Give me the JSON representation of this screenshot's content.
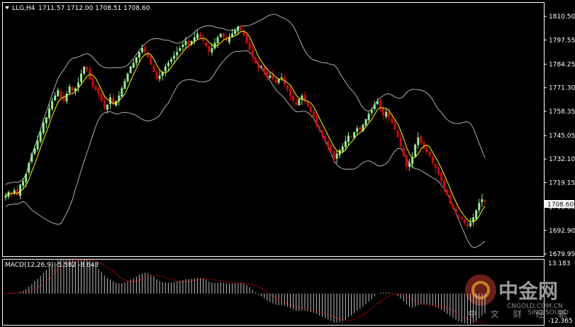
{
  "header": {
    "symbol_label": "LLG,H4",
    "ohlc": "1711.57 1712.00 1708.51 1708.60"
  },
  "price_axis": {
    "ticks": [
      "1810.50",
      "1797.55",
      "1784.25",
      "1771.30",
      "1758.35",
      "1745.05",
      "1732.10",
      "1719.15",
      "1705.85",
      "1692.90",
      "1679.95"
    ],
    "current_price": "1708.60"
  },
  "macd": {
    "label": "MACD(12,26,9) -5.582 -8.648",
    "ticks": [
      "13.183",
      "-12.365"
    ]
  },
  "watermark": {
    "brand_cn": "中金网",
    "domain": "CNGOLD.COM.CN",
    "slogan_cn": "中 文 财 经 新 闻",
    "sinosound": "SINO SOUND"
  },
  "colors": {
    "bull": "#90ee90",
    "bear": "#e00000",
    "band": "#b0b0b0",
    "ma": "#ffff00",
    "macd_hist": "#c0c0c0",
    "signal": "#ff0000",
    "frame": "#ffffff"
  },
  "chart_data": {
    "type": "candlestick",
    "y_range": [
      1679.95,
      1812.5
    ],
    "closes": [
      1712,
      1714,
      1713,
      1715,
      1712,
      1718,
      1720,
      1724,
      1730,
      1735,
      1738,
      1742,
      1747,
      1752,
      1755,
      1760,
      1764,
      1767,
      1770,
      1766,
      1764,
      1768,
      1772,
      1770,
      1771,
      1774,
      1779,
      1783,
      1781,
      1776,
      1772,
      1770,
      1768,
      1764,
      1760,
      1762,
      1766,
      1762,
      1764,
      1767,
      1771,
      1775,
      1779,
      1783,
      1785,
      1788,
      1791,
      1793,
      1791,
      1788,
      1784,
      1780,
      1776,
      1778,
      1780,
      1783,
      1785,
      1787,
      1789,
      1791,
      1793,
      1795,
      1797,
      1795,
      1797,
      1799,
      1801,
      1799,
      1797,
      1794,
      1791,
      1793,
      1796,
      1799,
      1801,
      1799,
      1797,
      1799,
      1801,
      1803,
      1805,
      1803,
      1800,
      1796,
      1792,
      1788,
      1785,
      1782,
      1783,
      1780,
      1777,
      1778,
      1776,
      1774,
      1776,
      1777,
      1773,
      1770,
      1767,
      1764,
      1762,
      1765,
      1767,
      1764,
      1761,
      1758,
      1755,
      1751,
      1748,
      1745,
      1742,
      1739,
      1736,
      1732,
      1735,
      1737,
      1739,
      1742,
      1745,
      1744,
      1747,
      1749,
      1748,
      1751,
      1754,
      1757,
      1759,
      1762,
      1764,
      1760,
      1756,
      1758,
      1755,
      1752,
      1748,
      1744,
      1739,
      1734,
      1728,
      1730,
      1733,
      1740,
      1744,
      1741,
      1738,
      1736,
      1734,
      1730,
      1727,
      1724,
      1720,
      1716,
      1712,
      1708,
      1705,
      1702,
      1700,
      1699,
      1697,
      1695,
      1697,
      1700,
      1704,
      1708,
      1710,
      1709
    ]
  }
}
